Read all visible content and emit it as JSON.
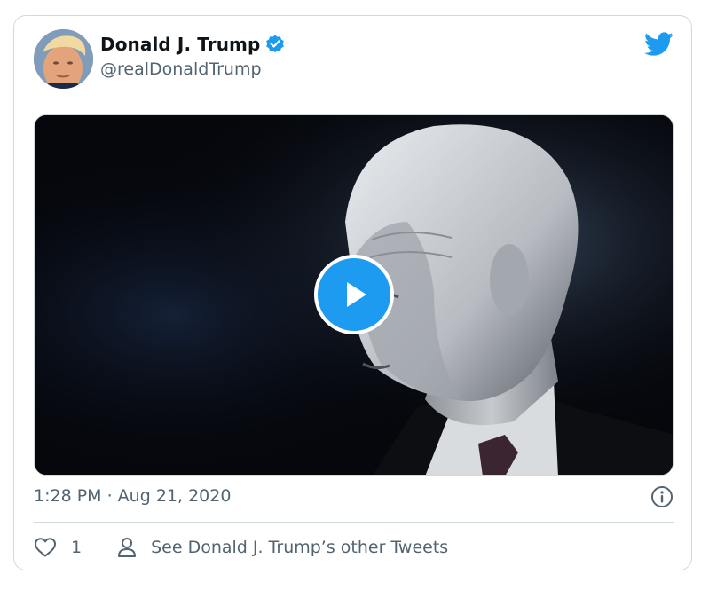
{
  "author": {
    "display_name": "Donald J. Trump",
    "handle": "@realDonaldTrump",
    "verified": true,
    "avatar_icon": "profile-photo"
  },
  "brand": {
    "icon": "twitter-bird-icon",
    "color": "#1d9bf0"
  },
  "media": {
    "type": "video",
    "play_icon": "play-icon"
  },
  "meta": {
    "timestamp": "1:28 PM · Aug 21, 2020",
    "info_icon": "info-icon"
  },
  "actions": {
    "like_count": "1",
    "see_others": "See Donald J. Trump’s other Tweets"
  },
  "colors": {
    "text_primary": "#0f1419",
    "text_secondary": "#536471",
    "border": "#cfd9de",
    "accent": "#1d9bf0"
  }
}
